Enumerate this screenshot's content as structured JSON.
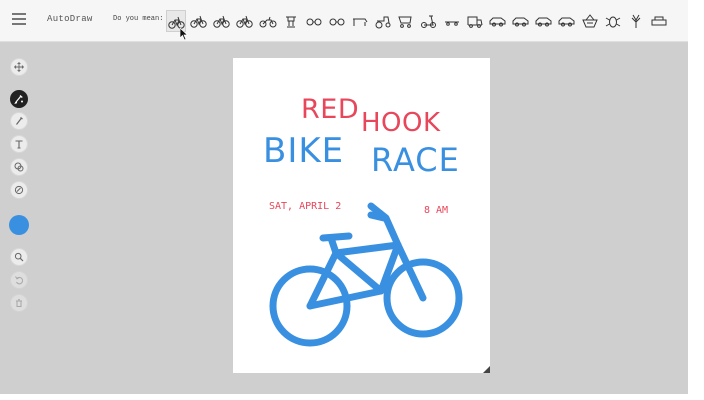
{
  "header": {
    "app_name": "AutoDraw",
    "suggest_label": "Do you mean:",
    "suggestions": [
      {
        "icon": "bicycle-icon"
      },
      {
        "icon": "bicycle-icon"
      },
      {
        "icon": "bicycle-icon"
      },
      {
        "icon": "bicycle-icon"
      },
      {
        "icon": "motorcycle-icon"
      },
      {
        "icon": "crown-icon"
      },
      {
        "icon": "glasses-icon"
      },
      {
        "icon": "glasses-icon"
      },
      {
        "icon": "bench-icon"
      },
      {
        "icon": "tractor-icon"
      },
      {
        "icon": "cart-icon"
      },
      {
        "icon": "scooter-icon"
      },
      {
        "icon": "skateboard-icon"
      },
      {
        "icon": "truck-icon"
      },
      {
        "icon": "car-icon"
      },
      {
        "icon": "car-icon"
      },
      {
        "icon": "car-icon"
      },
      {
        "icon": "car-icon"
      },
      {
        "icon": "basket-icon"
      },
      {
        "icon": "bug-icon"
      },
      {
        "icon": "plant-icon"
      },
      {
        "icon": "sofa-icon"
      }
    ]
  },
  "toolbar": {
    "tools": [
      "move-tool",
      "autodraw-tool",
      "draw-tool",
      "type-tool",
      "fill-tool",
      "shape-tool"
    ],
    "active_tool": "autodraw-tool",
    "color": "#3a90e0",
    "actions": [
      "zoom",
      "undo",
      "delete"
    ]
  },
  "poster": {
    "word1": "RED",
    "word2": "HOOK",
    "word3": "BIKE",
    "word4": "RACE",
    "date": "SAT, APRIL 2",
    "time": "8 AM",
    "red": "#e8465a",
    "blue": "#3a90e0"
  }
}
